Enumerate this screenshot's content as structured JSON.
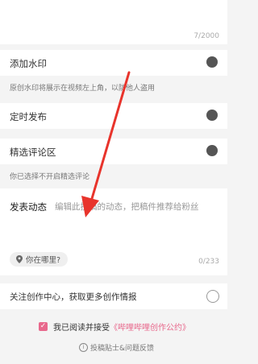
{
  "title_counter": "7/2000",
  "watermark": {
    "label": "添加水印",
    "hint": "原创水印将展示在视频左上角，以防他人盗用",
    "toggle_state": "off"
  },
  "scheduled": {
    "label": "定时发布",
    "toggle_state": "off"
  },
  "featured_comments": {
    "label": "精选评论区",
    "hint": "你已选择不开启精选评论",
    "toggle_state": "off"
  },
  "post_dynamic": {
    "label": "发表动态",
    "placeholder": "编辑此投稿的动态，把稿件推荐给粉丝",
    "counter": "0/233"
  },
  "location": {
    "label": "你在哪里?"
  },
  "follow_center": {
    "label": "关注创作中心，获取更多创作情报",
    "checked": false
  },
  "agreement": {
    "prefix": "我已阅读并接受",
    "link": "《哔哩哔哩创作公约》",
    "checked": true
  },
  "tips": {
    "label": "投稿贴士&问题反馈"
  },
  "colors": {
    "accent": "#e8688c",
    "annotation_arrow": "#e8342c"
  }
}
